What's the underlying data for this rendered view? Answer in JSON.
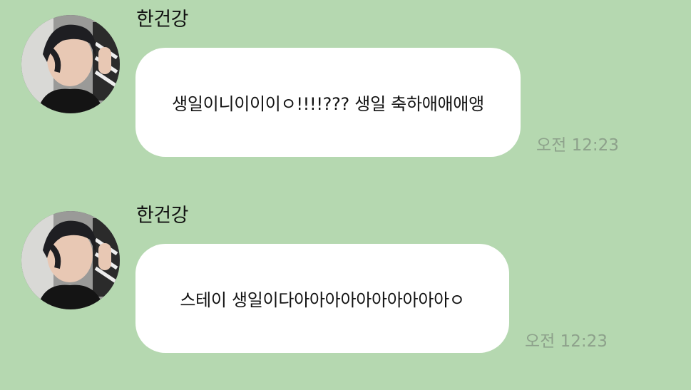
{
  "colors": {
    "background": "#b5d8b0",
    "bubble": "#ffffff",
    "timestamp": "#8da18b",
    "text": "#111111"
  },
  "messages": [
    {
      "sender": "한건강",
      "avatar_icon": "profile-photo-peace-sign",
      "text": "생일이니이이이ㅇ!!!!??? 생일 축하애애애앵",
      "time": "오전 12:23"
    },
    {
      "sender": "한건강",
      "avatar_icon": "profile-photo-peace-sign",
      "text": "스테이 생일이다아아아아아아아아아아ㅇ",
      "time": "오전 12:23"
    }
  ]
}
